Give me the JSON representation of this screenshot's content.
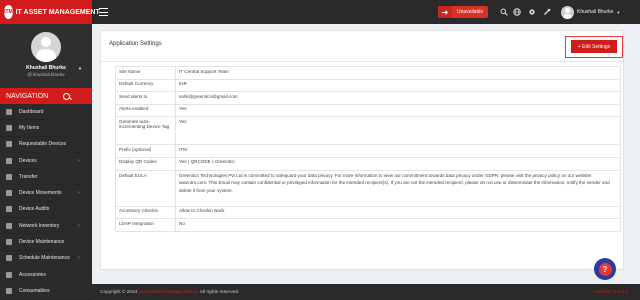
{
  "brand": {
    "logo_mark": "ITM",
    "name": "IT ASSET MANAGEMENT",
    "color": "#d21c1c"
  },
  "header": {
    "status_label": "Unavailable",
    "status_icon": "arrow-right-icon",
    "icons": [
      "search-icon",
      "globe-icon",
      "settings-icon",
      "tools-icon"
    ],
    "user_name": "Khushali Bhurke"
  },
  "sidebar": {
    "profile": {
      "name": "Khushali Bhurke",
      "handle": "@ khushali.bhurke"
    },
    "nav_title": "NAVIGATION",
    "items": [
      {
        "label": "Dashboard",
        "icon": "dashboard-icon",
        "has_children": false
      },
      {
        "label": "My Items",
        "icon": "box-icon",
        "has_children": false
      },
      {
        "label": "Requestable Devices",
        "icon": "devices-icon",
        "has_children": false
      },
      {
        "label": "Devices",
        "icon": "laptop-icon",
        "has_children": true
      },
      {
        "label": "Transfer",
        "icon": "transfer-icon",
        "has_children": false
      },
      {
        "label": "Device Movements",
        "icon": "movement-icon",
        "has_children": true
      },
      {
        "label": "Device Audits",
        "icon": "audit-icon",
        "has_children": false
      },
      {
        "label": "Network Inventory",
        "icon": "network-icon",
        "has_children": true
      },
      {
        "label": "Device Maintenance",
        "icon": "wrench-icon",
        "has_children": false
      },
      {
        "label": "Schedule Maintenance",
        "icon": "calendar-icon",
        "has_children": true
      },
      {
        "label": "Accessories",
        "icon": "keyboard-icon",
        "has_children": false
      },
      {
        "label": "Consumables",
        "icon": "consumables-icon",
        "has_children": false
      }
    ]
  },
  "main": {
    "title": "Application Settings",
    "edit_button": "+ Edit Settings",
    "settings": [
      {
        "key": "Site Name",
        "value": "IT Central Support Team"
      },
      {
        "key": "Default Currency",
        "value": "INR"
      },
      {
        "key": "Send alerts to",
        "value": "sahil@greenitco@gmail.com"
      },
      {
        "key": "Alerts enabled",
        "value": "Yes"
      },
      {
        "key": "Generate auto-incrementing Device Tag",
        "value": "Yes"
      },
      {
        "key": "Prefix (optional)",
        "value": "ITM"
      },
      {
        "key": "Display QR Codes",
        "value": "Yes ( QRCODE ) Greenitco"
      },
      {
        "key": "Default EULA",
        "value": "Greenitco Technologies Pvt Ltd is committed to safeguard your data privacy. For more information to view our commitment towards data privacy under GDPR, please visit the privacy policy on our website www.itm.com. This Email may contain confidential or privileged information for the intended recipient(s). If you are not the intended recipient, please do not use or disseminate the information, notify the sender and delete it from your system."
      },
      {
        "key": "Accessory Checkin",
        "value": "Allow to Checkin Back"
      },
      {
        "key": "LDAP Integration",
        "value": "No"
      }
    ]
  },
  "footer": {
    "copyright": "Copyright © 2024",
    "link": "www.itassetmanagement.in",
    "rights": "All rights reserved.",
    "version": "Version: 2.4.0.3"
  },
  "help_icon": "help-chat-icon"
}
